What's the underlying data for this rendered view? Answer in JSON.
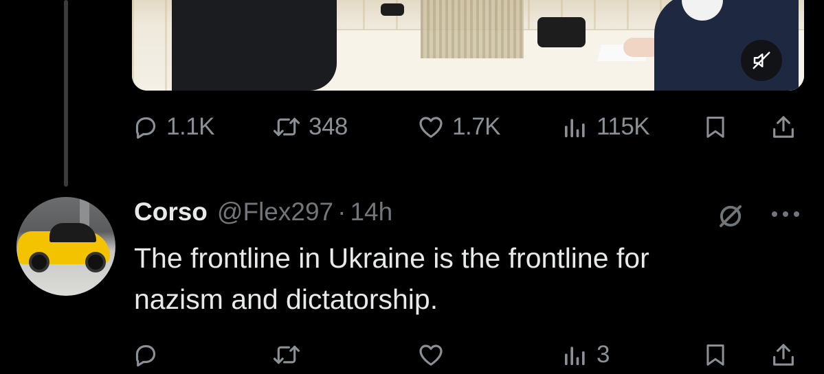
{
  "parent_tweet": {
    "stats": {
      "replies": "1.1K",
      "reposts": "348",
      "likes": "1.7K",
      "views": "115K"
    }
  },
  "reply_tweet": {
    "display_name": "Corso",
    "handle": "@Flex297",
    "separator": "·",
    "time": "14h",
    "text_line_1": "The frontline in Ukraine is the frontline for",
    "text_line_2": "nazism and dictatorship.",
    "stats": {
      "views": "3"
    }
  },
  "icons": {
    "reply": "reply-icon",
    "repost": "repost-icon",
    "like": "heart-icon",
    "views": "views-icon",
    "bookmark": "bookmark-icon",
    "share": "share-icon",
    "mute": "speaker-muted-icon",
    "grok": "grok-icon",
    "more": "more-horizontal-icon"
  },
  "colors": {
    "background": "#000000",
    "text_primary": "#e7e9ea",
    "text_secondary": "#71767b",
    "thread_line": "#3a3d40"
  }
}
